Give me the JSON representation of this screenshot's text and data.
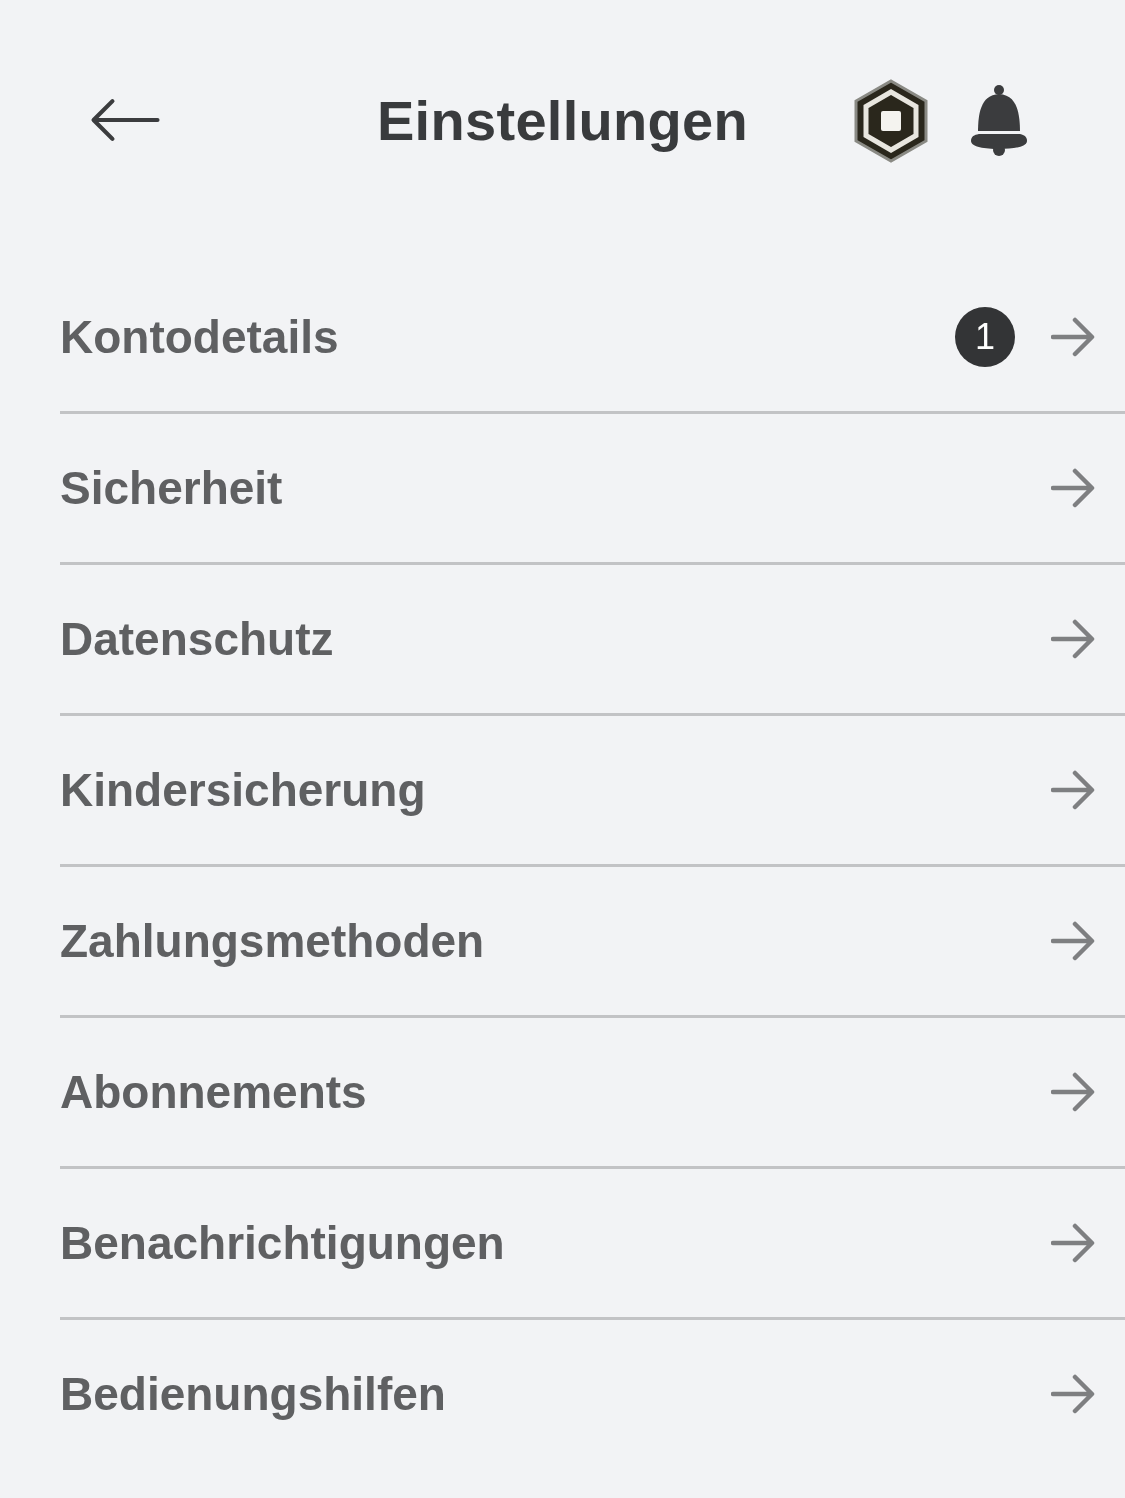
{
  "header": {
    "title": "Einstellungen"
  },
  "items": [
    {
      "label": "Kontodetails",
      "badge": "1"
    },
    {
      "label": "Sicherheit"
    },
    {
      "label": "Datenschutz"
    },
    {
      "label": "Kindersicherung"
    },
    {
      "label": "Zahlungsmethoden"
    },
    {
      "label": "Abonnements"
    },
    {
      "label": "Benachrichtigungen"
    },
    {
      "label": "Bedienungshilfen"
    }
  ]
}
